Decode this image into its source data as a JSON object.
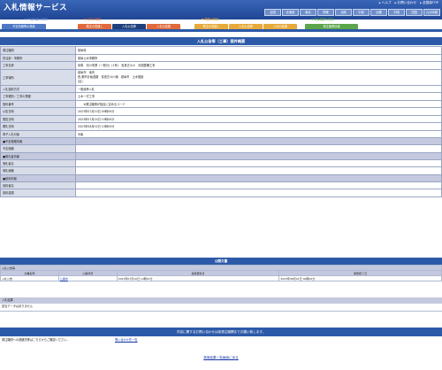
{
  "header": {
    "title": "入札情報サービス",
    "links": [
      "ヘルプ",
      "お問い合わせ",
      "全国版TOP"
    ],
    "regions": [
      "全国",
      "北海道",
      "東北",
      "関東",
      "北陸",
      "中部",
      "近畿",
      "中国",
      "四国",
      "九州沖縄"
    ]
  },
  "nav": {
    "groups": [
      {
        "label": "予定情報の検索",
        "color": "#6e8fcc"
      },
      {
        "label": "工事の検索",
        "color": "#e06a3c"
      },
      {
        "label": "業務の検索",
        "color": "#e6a93a"
      },
      {
        "label": "発注機関の検索",
        "color": "#5ba54a"
      }
    ],
    "tabs": [
      {
        "label": "予定情報等の検索",
        "color": "#4e78c4"
      },
      {
        "label": "発注の見通し",
        "color": "#e06a3c"
      },
      {
        "label": "入札公告等",
        "color": "#1f3f7a"
      },
      {
        "label": "入札の結果",
        "color": "#e06a3c"
      },
      {
        "label": "発注の見通し",
        "color": "#e6a93a"
      },
      {
        "label": "入札公告等",
        "color": "#e6a93a"
      },
      {
        "label": "入札の結果",
        "color": "#e6a93a"
      },
      {
        "label": "発注機関情報",
        "color": "#5ba54a"
      }
    ]
  },
  "main": {
    "title": "入札公告等（工事）案件概要",
    "rows": [
      {
        "k": "発注機関",
        "v": "岐阜県"
      },
      {
        "k": "担当部・事務所",
        "v": "岐阜土木事務所"
      },
      {
        "k": "工事名称",
        "v": "県単　河川事業（一般分）(1号)　長良古々川　河道整備工事"
      },
      {
        "k": "工事場所",
        "v": "岐阜市　地内",
        "v2": "西  都市計画道路　長良古々川線　岐阜市　土木施設",
        "v3": "(区)"
      },
      {
        "k": "入札契約方式",
        "v": "一般競争入札"
      },
      {
        "k": "工事種別／工事の業種",
        "v": "土木一式工事"
      },
      {
        "k": "指針番号",
        "v": "　　※発注機関が独自に定めるコード"
      },
      {
        "k": "公告日時",
        "v": "2023年07月10日 00時00分"
      },
      {
        "k": "閲覧日時",
        "v": "2023年07月24日 10時00分"
      },
      {
        "k": "開札日時",
        "v": "2023年08月02日 10時00分"
      },
      {
        "k": "電子入札対象",
        "v": "対象"
      }
    ],
    "sec1": "■予定価格情報",
    "sec1_rows": [
      {
        "k": "予定価格",
        "v": ""
      }
    ],
    "sec2": "■落札者情報",
    "sec2_rows": [
      {
        "k": "落札者名",
        "v": ""
      },
      {
        "k": "落札価格",
        "v": ""
      }
    ],
    "sec3": "■契約情報",
    "sec3_rows": [
      {
        "k": "契約者名",
        "v": ""
      },
      {
        "k": "契約金額",
        "v": ""
      }
    ]
  },
  "public": {
    "title": "公開文書",
    "group": "入札公告等",
    "headers": [
      "文書名称",
      "公開状況",
      "最終更新日",
      "閲覧終了日"
    ],
    "rows": [
      {
        "name": "入札公告",
        "status": "公開中",
        "updated": "2023年07月10日 14時51分",
        "end": "2023年08月01日 00時00分"
      }
    ]
  },
  "notice": {
    "title": "入札結果",
    "body": "該当データはありません"
  },
  "inquiry": {
    "title": "内容に関するお問い合わせは各発注機関までお願い致します。",
    "label": "発注機関への連絡先等はこちらからご確認ください。",
    "link": "問い合わせ先一覧"
  },
  "back": "検索結果一覧画面に戻る"
}
